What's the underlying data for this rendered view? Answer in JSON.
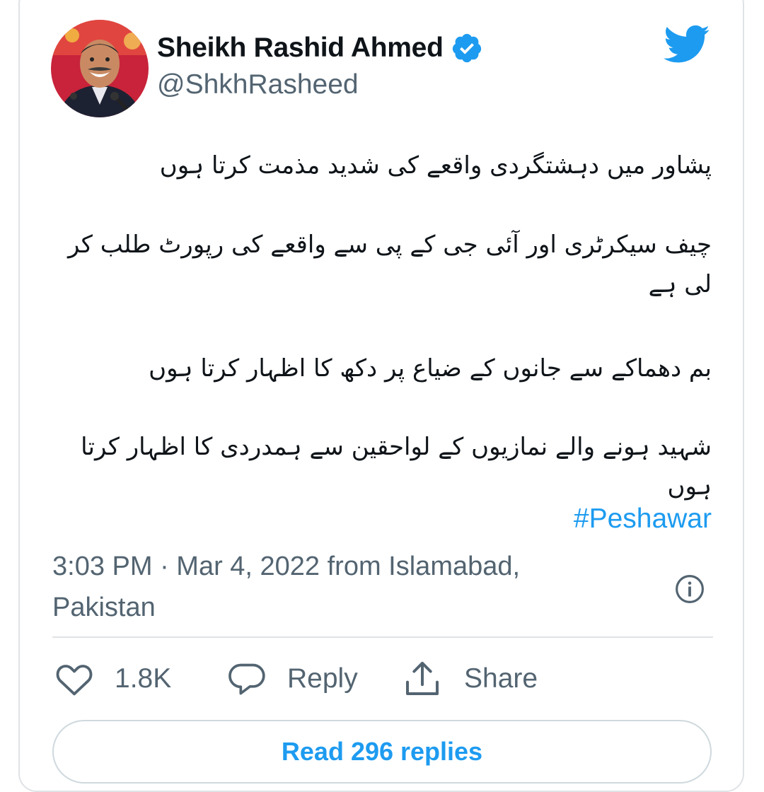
{
  "tweet": {
    "author_name": "Sheikh Rashid Ahmed",
    "author_handle": "@ShkhRasheed",
    "verified": true,
    "paragraphs": [
      "پشاور میں دہشتگردی واقعے کی شدید مذمت کرتا ہوں",
      "چیف سیکرٹری اور آئی جی کے پی سے واقعے کی رپورٹ طلب کر لی ہے",
      "بم دھماکے سے جانوں کے ضیاع پر دکھ کا اظہار کرتا ہوں",
      "شہید ہونے والے نمازیوں کے لواحقین سے ہمدردی کا اظہار کرتا ہوں"
    ],
    "hashtag": "#Peshawar",
    "timestamp": "3:03 PM · Mar 4, 2022 from Islamabad, Pakistan"
  },
  "actions": {
    "like_count": "1.8K",
    "reply_label": "Reply",
    "share_label": "Share"
  },
  "replies_button": "Read 296 replies",
  "icons": {
    "logo": "twitter-bird-icon",
    "verified": "verified-badge-icon",
    "info": "info-icon",
    "like": "heart-icon",
    "reply": "comment-icon",
    "share": "share-icon"
  },
  "colors": {
    "accent": "#1d9bf0",
    "text": "#0f1419",
    "muted": "#536471",
    "border": "#dfe3e6"
  }
}
